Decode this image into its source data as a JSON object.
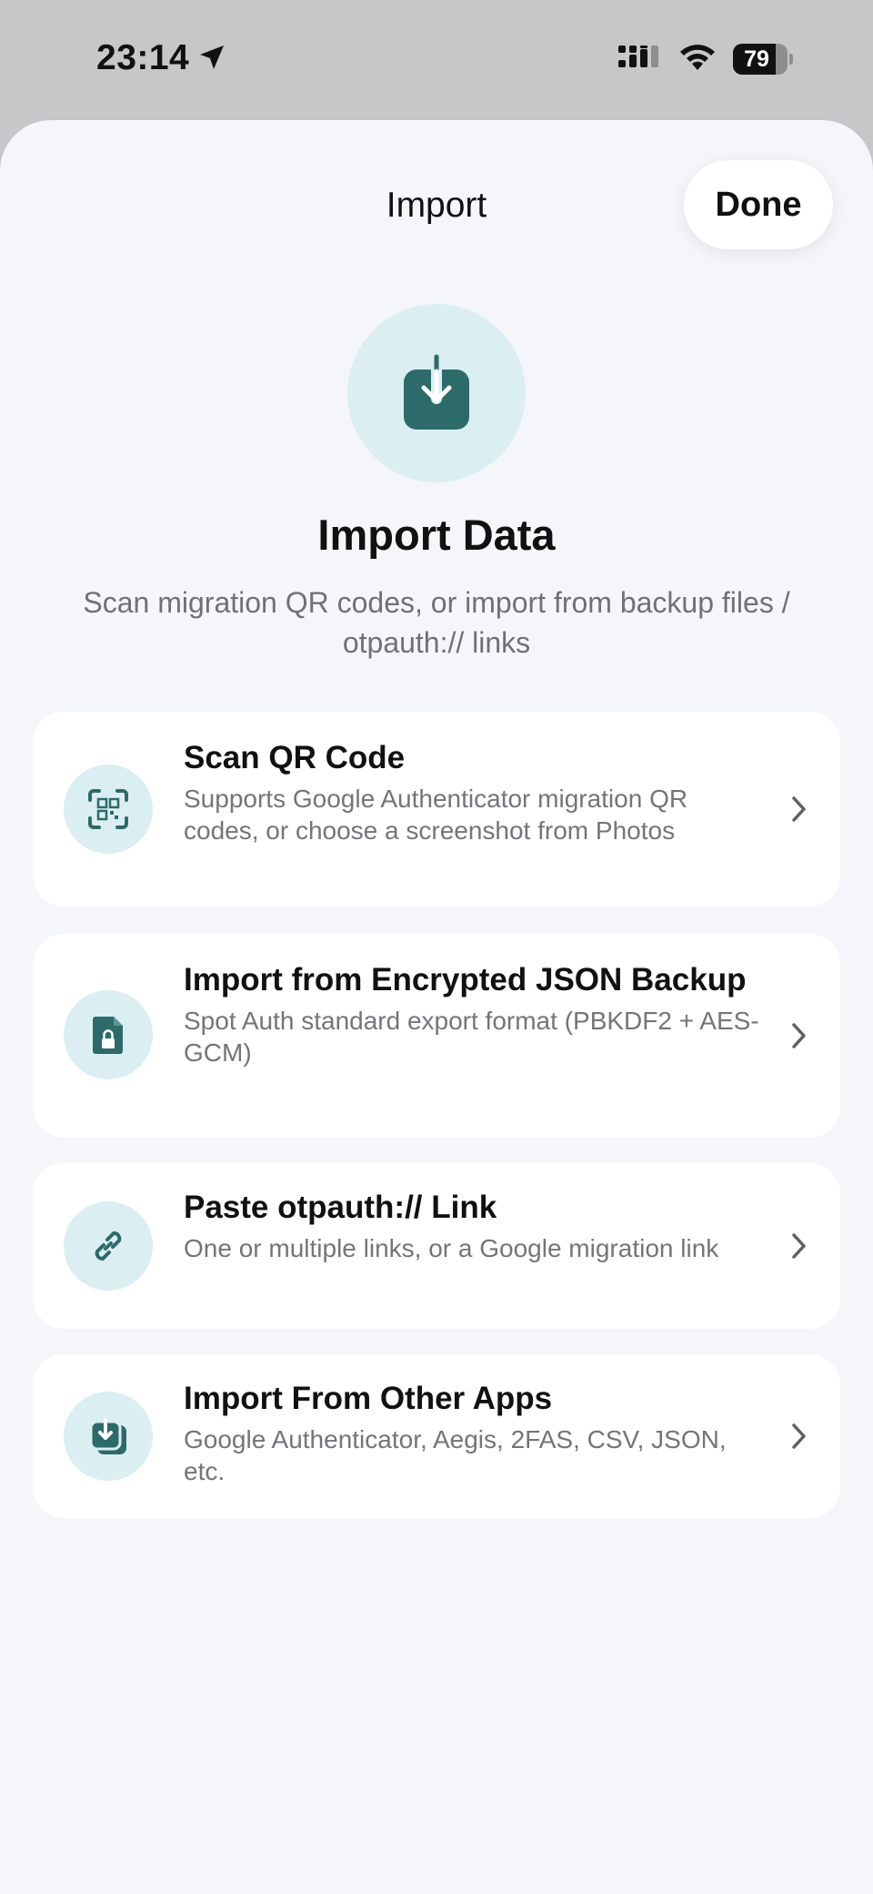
{
  "status_bar": {
    "time": "23:14",
    "battery": "79",
    "battery_level": 0.79
  },
  "sheet": {
    "title": "Import",
    "done_label": "Done"
  },
  "hero": {
    "title": "Import Data",
    "subtitle": "Scan migration QR codes, or import from backup files / otpauth:// links"
  },
  "options": [
    {
      "title": "Scan QR Code",
      "description": "Supports Google Authenticator migration QR codes, or choose a screenshot from Photos",
      "icon": "qr-scan-icon"
    },
    {
      "title": "Import from Encrypted JSON Backup",
      "description": "Spot Auth standard export format (PBKDF2 + AES-GCM)",
      "icon": "locked-file-icon"
    },
    {
      "title": "Paste otpauth:// Link",
      "description": "One or multiple links, or a Google migration link",
      "icon": "link-icon"
    },
    {
      "title": "Import From Other Apps",
      "description": "Google Authenticator, Aegis, 2FAS, CSV, JSON, etc.",
      "icon": "import-stack-icon"
    }
  ],
  "colors": {
    "accent": "#2d6b6a",
    "icon_bg": "#dbeef2",
    "sheet_bg": "#f5f6fa"
  }
}
